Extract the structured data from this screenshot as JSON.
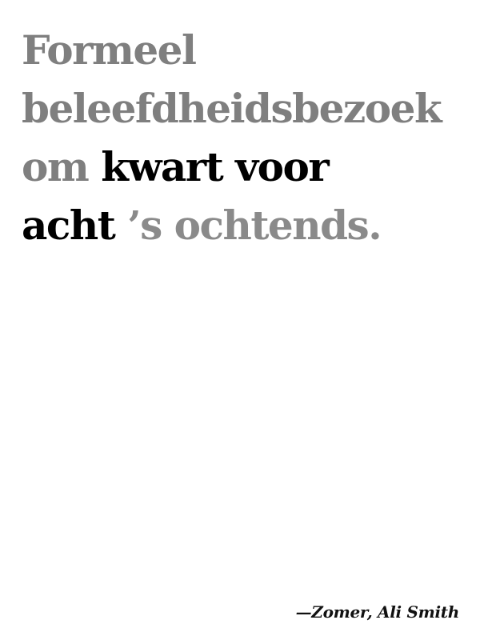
{
  "quote": {
    "line1": "Formeel",
    "line2": "beleefdheidsbezoek",
    "line3_plain": "om",
    "line3_emph": "kwart voor",
    "line4_emph": "acht",
    "line4_plain": "’s ochtends."
  },
  "attribution": "—Zomer, Ali Smith",
  "colors": {
    "muted_text": "#7f7f7f",
    "emphasis_text": "#000000",
    "background": "#ffffff"
  }
}
